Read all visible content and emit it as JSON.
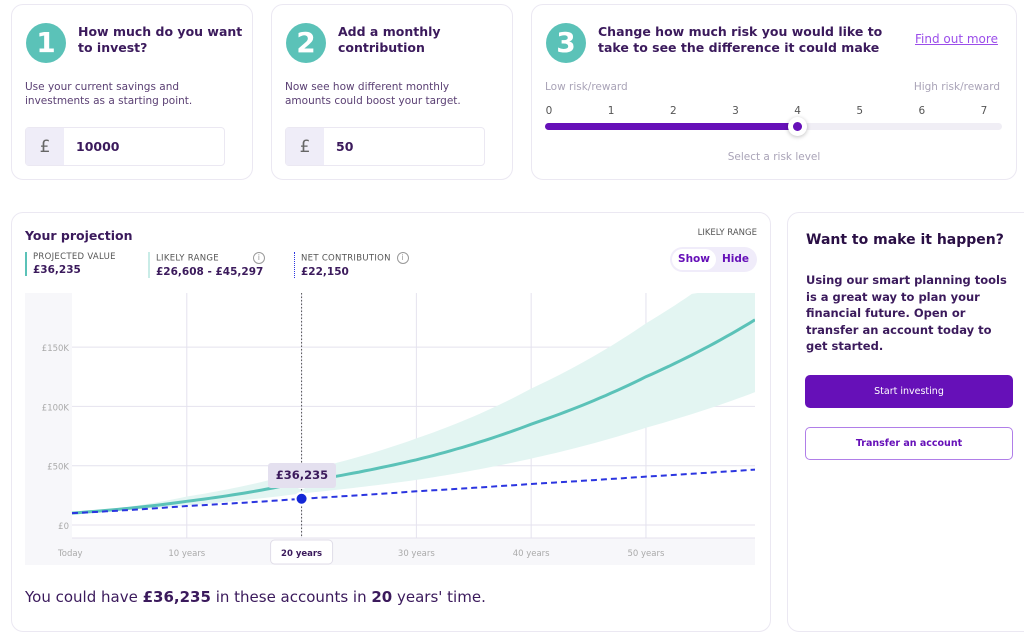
{
  "step1": {
    "number": "1",
    "title": "How much do you want to invest?",
    "description": "Use your current savings and investments as a starting point.",
    "currency": "£",
    "value": "10000"
  },
  "step2": {
    "number": "2",
    "title": "Add a monthly contribution",
    "description": "Now see how different monthly amounts could boost your target.",
    "currency": "£",
    "value": "50"
  },
  "step3": {
    "number": "3",
    "title": "Change how much risk you would like to take to see the difference it could make",
    "link": "Find out more",
    "low_label": "Low risk/reward",
    "high_label": "High risk/reward",
    "ticks": [
      "0",
      "1",
      "2",
      "3",
      "4",
      "5",
      "6",
      "7"
    ],
    "selected_level": 4,
    "max_level": 7,
    "hint": "Select a risk level"
  },
  "projection": {
    "title": "Your projection",
    "likely_range_toggle_label": "LIKELY RANGE",
    "toggle": {
      "show": "Show",
      "hide": "Hide",
      "selected": "Show"
    },
    "stats": [
      {
        "label": "PROJECTED VALUE",
        "value": "£36,235"
      },
      {
        "label": "LIKELY RANGE",
        "value": "£26,608 - £45,297",
        "info": "i"
      },
      {
        "label": "NET CONTRIBUTION",
        "value": "£22,150",
        "info": "i"
      }
    ],
    "tooltip": "£36,235",
    "summary": {
      "prefix": "You could have ",
      "amount": "£36,235",
      "middle": " in these accounts in ",
      "years": "20",
      "suffix": " years' time."
    }
  },
  "chart_data": {
    "type": "line",
    "x_tick_labels": [
      "Today",
      "10 years",
      "20 years",
      "30 years",
      "40 years",
      "50 years"
    ],
    "x_ticks": [
      0,
      10,
      20,
      30,
      40,
      50
    ],
    "y_tick_labels": [
      "£0",
      "£50K",
      "£100K",
      "£150K"
    ],
    "y_ticks": [
      0,
      50000,
      100000,
      150000
    ],
    "xlim": [
      0,
      59.5
    ],
    "ylim": [
      0,
      195000
    ],
    "grid": true,
    "selected_x": 20,
    "x": [
      0,
      10,
      20,
      30,
      40,
      50,
      59.5
    ],
    "series": [
      {
        "key": "projected",
        "values": [
          10000,
          20000,
          36235,
          55000,
          85000,
          125000,
          173000
        ],
        "color": "#5bc2b8",
        "style": "solid"
      },
      {
        "key": "contribution",
        "values": [
          10000,
          16000,
          22150,
          28400,
          34600,
          40800,
          46700
        ],
        "color": "#2b35e0",
        "style": "dashed"
      }
    ],
    "band": {
      "lower": [
        10000,
        16500,
        26608,
        38000,
        56000,
        82000,
        112000
      ],
      "upper": [
        10000,
        24000,
        45297,
        73000,
        115000,
        170000,
        235000
      ],
      "color": "#e3f5f2"
    }
  },
  "cta": {
    "title": "Want to make it happen?",
    "body": "Using our smart planning tools is a great way to plan your financial future. Open or transfer an account today to get started.",
    "primary": "Start investing",
    "secondary": "Transfer an account"
  },
  "colors": {
    "accent": "#6610b8",
    "teal": "#5bc2b8",
    "text": "#3b1a5c"
  }
}
